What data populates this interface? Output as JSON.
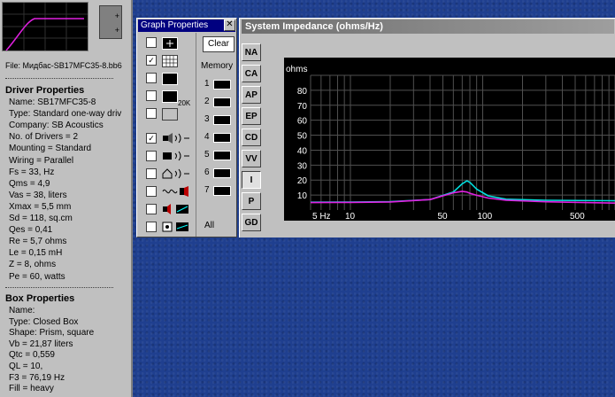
{
  "left_panel": {
    "file_label": "File: Мидбас-SB17MFC35-8.bb6",
    "driver_title": "Driver Properties",
    "driver_lines": [
      "Name: SB17MFC35-8",
      "Type: Standard one-way driv",
      "Company: SB Acoustics",
      "No. of Drivers = 2",
      "Mounting = Standard",
      "Wiring = Parallel",
      "Fs =  33, Hz",
      "Qms = 4,9",
      "Vas = 38, liters",
      "Xmax = 5,5 mm",
      "Sd = 118, sq.cm",
      "Qes = 0,41",
      "Re = 5,7 ohms",
      "Le = 0,15 mH",
      "Z = 8, ohms",
      "Pe = 60, watts"
    ],
    "box_title": "Box Properties",
    "box_lines": [
      "Name:",
      "Type: Closed Box",
      "Shape: Prism, square",
      "Vb = 21,87 liters",
      "Qtc = 0,559",
      "QL = 10,",
      "F3 = 76,19 Hz",
      "Fill = heavy"
    ],
    "speaker_plus": "+"
  },
  "graph_properties": {
    "title": "Graph Properties",
    "close": "✕",
    "clear": "Clear",
    "memory_label": "Memory",
    "memory_slots": [
      "1",
      "2",
      "3",
      "4",
      "5",
      "6",
      "7"
    ],
    "all_label": "All",
    "checks": [
      "",
      "✓",
      "",
      "",
      "",
      "✓",
      "",
      "",
      "",
      "",
      ""
    ],
    "icon_20k": "20K"
  },
  "impedance": {
    "title": "System Impedance (ohms/Hz)",
    "tabs": [
      "NA",
      "CA",
      "AP",
      "EP",
      "CD",
      "VV",
      "I",
      "P",
      "GD"
    ],
    "active_tab": "I",
    "colors": {
      "series1": "#00e0e0",
      "series2": "#e020e0",
      "grid": "#505050",
      "bg": "#000000"
    }
  },
  "chart_data": {
    "type": "line",
    "ylabel": "ohms",
    "xlabel": "",
    "y_ticks": [
      "80",
      "70",
      "60",
      "50",
      "40",
      "30",
      "20",
      "10"
    ],
    "x_ticks": [
      "5 Hz",
      "10",
      "50",
      "100",
      "500"
    ],
    "ylim": [
      0,
      90
    ],
    "xlim": [
      5,
      1000
    ],
    "x_scale": "log",
    "grid": true,
    "series": [
      {
        "x": [
          5,
          10,
          20,
          40,
          60,
          70,
          76,
          80,
          90,
          110,
          150,
          300,
          1000
        ],
        "y": [
          5.2,
          5.3,
          5.6,
          7.0,
          12.0,
          17.5,
          19.5,
          18.5,
          14.0,
          9.5,
          7.2,
          6.5,
          6.2
        ]
      },
      {
        "x": [
          5,
          10,
          20,
          40,
          60,
          70,
          76,
          80,
          90,
          110,
          150,
          300,
          1000
        ],
        "y": [
          5.0,
          5.1,
          5.4,
          7.0,
          11.5,
          12.5,
          12.0,
          11.2,
          9.8,
          8.0,
          6.5,
          5.5,
          4.6
        ]
      }
    ]
  }
}
